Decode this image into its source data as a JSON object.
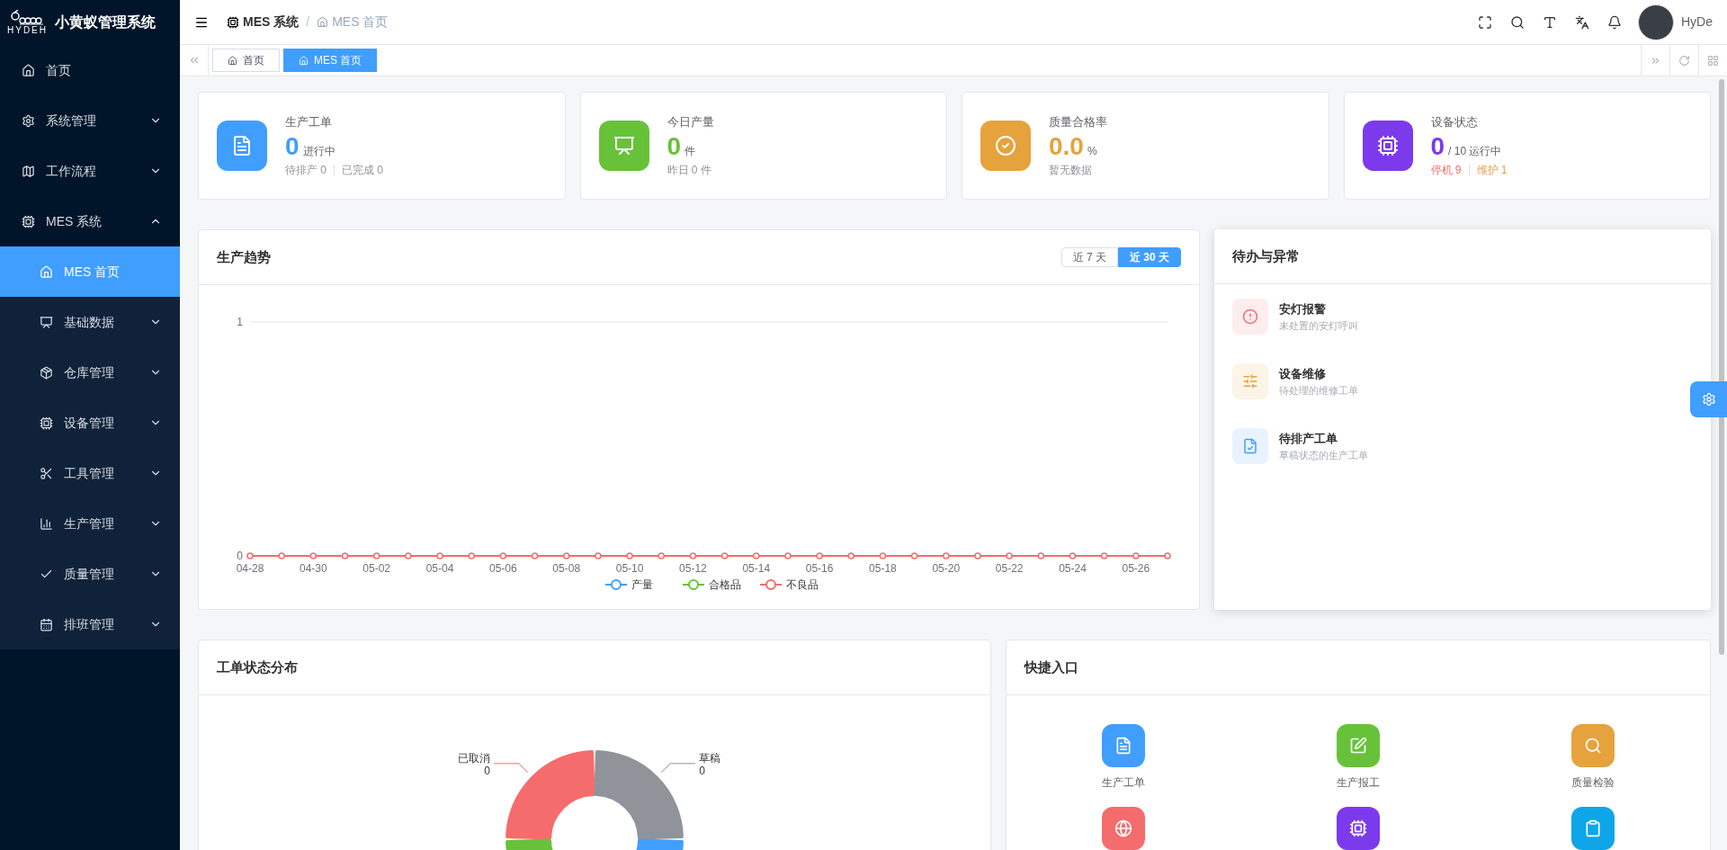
{
  "app": {
    "title": "小黄蚁管理系统",
    "logo_text": "HYDEH"
  },
  "sidebar": {
    "items": [
      {
        "label": "首页",
        "selected": false
      },
      {
        "label": "系统管理",
        "selected": false,
        "expanded": false
      },
      {
        "label": "工作流程",
        "selected": false,
        "expanded": false
      },
      {
        "label": "MES 系统",
        "selected": false,
        "expanded": true,
        "children": [
          {
            "label": "MES 首页",
            "selected": true
          },
          {
            "label": "基础数据",
            "selected": false,
            "expanded": false
          },
          {
            "label": "仓库管理",
            "selected": false,
            "expanded": false
          },
          {
            "label": "设备管理",
            "selected": false,
            "expanded": false
          },
          {
            "label": "工具管理",
            "selected": false,
            "expanded": false
          },
          {
            "label": "生产管理",
            "selected": false,
            "expanded": false
          },
          {
            "label": "质量管理",
            "selected": false,
            "expanded": false
          },
          {
            "label": "排班管理",
            "selected": false,
            "expanded": false
          }
        ]
      }
    ]
  },
  "breadcrumb": [
    "MES 系统",
    "/",
    "MES 首页"
  ],
  "user": {
    "name": "HyDe"
  },
  "tabs": [
    {
      "label": "首页",
      "selected": false
    },
    {
      "label": "MES 首页",
      "selected": true
    }
  ],
  "stats": [
    {
      "title": "生产工单",
      "value": "0",
      "unit": "进行中",
      "color": "#409eff",
      "notes": [
        {
          "text": "待排产 0",
          "color": "#909399"
        },
        {
          "text": "已完成 0",
          "color": "#909399"
        }
      ]
    },
    {
      "title": "今日产量",
      "value": "0",
      "unit": "件",
      "color": "#67c23a",
      "notes": [
        {
          "text": "昨日 0 件",
          "color": "#909399"
        }
      ]
    },
    {
      "title": "质量合格率",
      "value": "0.0",
      "unit": "%",
      "color": "#e6a23c",
      "notes": [
        {
          "text": "暂无数据",
          "color": "#909399"
        }
      ]
    },
    {
      "title": "设备状态",
      "value": "0",
      "unit": "/ 10 运行中",
      "color": "#7c3aed",
      "notes": [
        {
          "text": "停机 9",
          "color": "#f56c6c"
        },
        {
          "text": "维护 1",
          "color": "#e6a23c"
        }
      ]
    }
  ],
  "trend": {
    "title": "生产趋势",
    "ranges": [
      {
        "label": "近 7 天",
        "selected": false
      },
      {
        "label": "近 30 天",
        "selected": true
      }
    ],
    "chart_data": {
      "type": "line",
      "categories": [
        "04-28",
        null,
        "04-30",
        null,
        "05-02",
        null,
        "05-04",
        null,
        "05-06",
        null,
        "05-08",
        null,
        "05-10",
        null,
        "05-12",
        null,
        "05-14",
        null,
        "05-16",
        null,
        "05-18",
        null,
        "05-20",
        null,
        "05-22",
        null,
        "05-24",
        null,
        "05-26",
        null
      ],
      "yticks": [
        0,
        1
      ],
      "ylim": [
        0,
        1
      ],
      "legend": "bottom",
      "series": [
        {
          "name": "产量",
          "color": "#409eff",
          "marker": "circle",
          "values": [
            null,
            null,
            null,
            null,
            null,
            null,
            null,
            null,
            null,
            null,
            null,
            null,
            null,
            null,
            null,
            null,
            null,
            null,
            null,
            null,
            null,
            null,
            null,
            null,
            null,
            null,
            null,
            null,
            null,
            null
          ]
        },
        {
          "name": "合格品",
          "color": "#67c23a",
          "marker": "circle",
          "values": [
            null,
            null,
            null,
            null,
            null,
            null,
            null,
            null,
            null,
            null,
            null,
            null,
            null,
            null,
            null,
            null,
            null,
            null,
            null,
            null,
            null,
            null,
            null,
            null,
            null,
            null,
            null,
            null,
            null,
            null
          ]
        },
        {
          "name": "不良品",
          "color": "#f56c6c",
          "marker": "circle",
          "values": [
            0,
            0,
            0,
            0,
            0,
            0,
            0,
            0,
            0,
            0,
            0,
            0,
            0,
            0,
            0,
            0,
            0,
            0,
            0,
            0,
            0,
            0,
            0,
            0,
            0,
            0,
            0,
            0,
            0,
            0
          ]
        }
      ]
    }
  },
  "todo": {
    "title": "待办与异常",
    "items": [
      {
        "title": "安灯报警",
        "subtitle": "未处置的安灯呼叫",
        "color": "#f56c6c"
      },
      {
        "title": "设备维修",
        "subtitle": "待处理的维修工单",
        "color": "#e6a23c"
      },
      {
        "title": "待排产工单",
        "subtitle": "草稿状态的生产工单",
        "color": "#409eff"
      }
    ]
  },
  "status_dist": {
    "title": "工单状态分布",
    "slices": [
      {
        "label": "已取消",
        "value": "0",
        "color": "#f56c6c"
      },
      {
        "label": "草稿",
        "value": "0",
        "color": "#909399"
      },
      {
        "color": "#409eff"
      },
      {
        "color": "#67c23a"
      }
    ]
  },
  "shortcuts": {
    "title": "快捷入口",
    "items": [
      {
        "label": "生产工单",
        "color": "#409eff"
      },
      {
        "label": "生产报工",
        "color": "#67c23a"
      },
      {
        "label": "质量检验",
        "color": "#e6a23c"
      },
      {
        "color": "#f56c6c"
      },
      {
        "color": "#7c3aed"
      },
      {
        "color": "#0ea5e9"
      }
    ]
  }
}
